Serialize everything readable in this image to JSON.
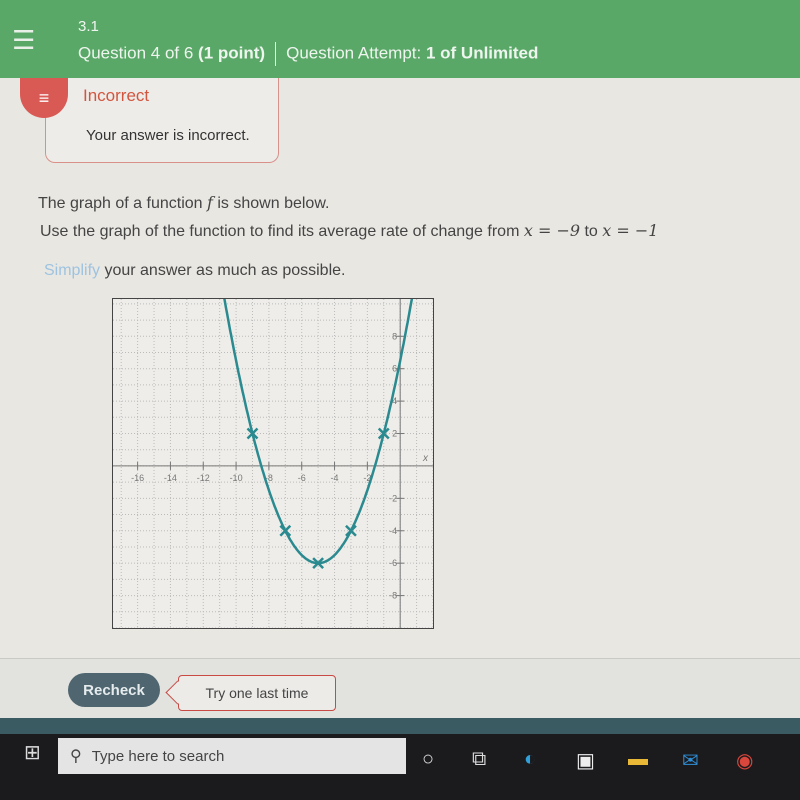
{
  "header": {
    "section": "3.1",
    "question": "Question 4 of 6",
    "points": "(1 point)",
    "attempt_label": "Question Attempt:",
    "attempt_value": "1 of Unlimited",
    "color": "#5aa868"
  },
  "feedback": {
    "title": "Incorrect",
    "message": "Your answer is incorrect.",
    "icon": "chat-icon"
  },
  "question": {
    "line1_a": "The graph of a function ",
    "line1_f": "f",
    "line1_b": " is shown below.",
    "line2": "Use the graph of the function to find its average rate of change from ",
    "x1": "x = −9",
    "to": " to ",
    "x2": "x = −1",
    ".": ".",
    "simplify": "Simplify",
    "line3": " your answer as much as possible."
  },
  "chart_data": {
    "type": "line",
    "function": "y = 0.5(x+5)^2 - 6",
    "xlabel": "x",
    "xlim": [
      -17.5,
      2
    ],
    "ylim": [
      -10,
      10.3
    ],
    "x_tick_labels": [
      "-16",
      "-14",
      "-12",
      "-10",
      "-8",
      "-6",
      "-4",
      "-2"
    ],
    "y_tick_labels": [
      "8",
      "6",
      "4",
      "2",
      "-2",
      "-4",
      "-6",
      "-8"
    ],
    "grid": true,
    "marked_points": [
      {
        "x": -9,
        "y": 2
      },
      {
        "x": -7,
        "y": -4
      },
      {
        "x": -5,
        "y": -6
      },
      {
        "x": -3,
        "y": -4
      },
      {
        "x": -1,
        "y": 2
      }
    ],
    "curve_color": "#2a8a90"
  },
  "actions": {
    "recheck": "Recheck",
    "tip": "Try one last time"
  },
  "taskbar": {
    "search_placeholder": "Type here to search"
  }
}
